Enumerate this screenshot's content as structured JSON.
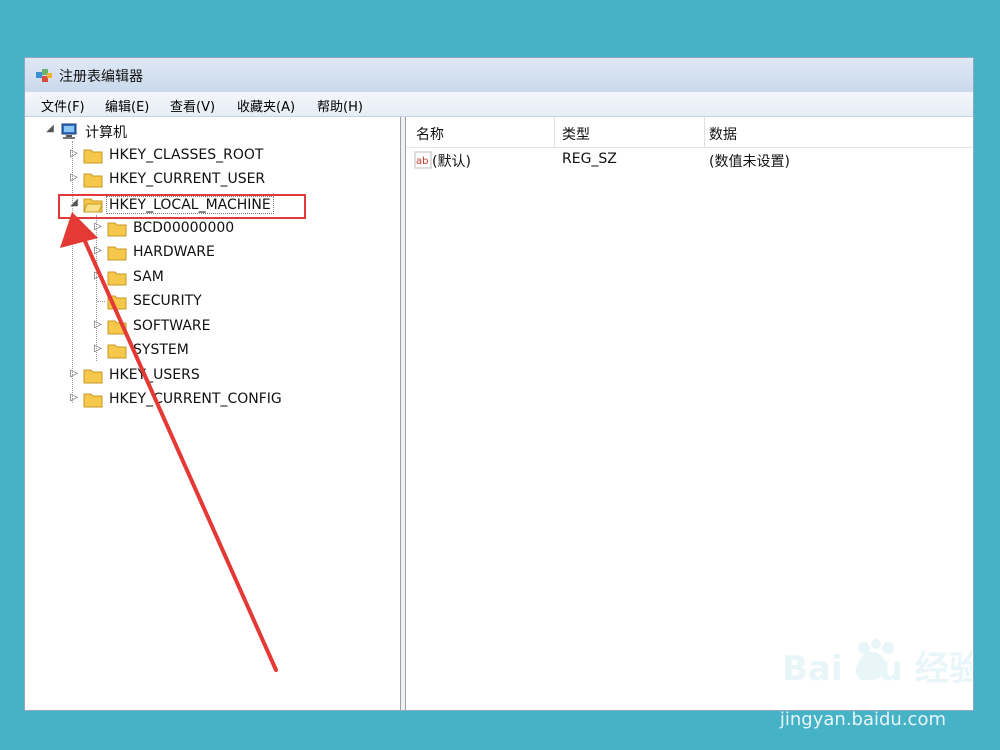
{
  "window": {
    "title": "注册表编辑器"
  },
  "menu": [
    "文件(F)",
    "编辑(E)",
    "查看(V)",
    "收藏夹(A)",
    "帮助(H)"
  ],
  "tree": {
    "root": "计算机",
    "hives": [
      {
        "label": "HKEY_CLASSES_ROOT"
      },
      {
        "label": "HKEY_CURRENT_USER"
      },
      {
        "label": "HKEY_LOCAL_MACHINE",
        "expanded": true,
        "selected": true
      },
      {
        "label": "HKEY_USERS"
      },
      {
        "label": "HKEY_CURRENT_CONFIG"
      }
    ],
    "children": [
      "BCD00000000",
      "HARDWARE",
      "SAM",
      "SECURITY",
      "SOFTWARE",
      "SYSTEM"
    ]
  },
  "list": {
    "columns": [
      "名称",
      "类型",
      "数据"
    ],
    "rows": [
      {
        "name": "(默认)",
        "type": "REG_SZ",
        "data": "(数值未设置)"
      }
    ]
  },
  "watermark": {
    "brand": "Bai du 经验",
    "url": "jingyan.baidu.com"
  },
  "colors": {
    "background": "#46b2c6",
    "highlight": "#e03a3a",
    "arrow": "#e53935"
  }
}
